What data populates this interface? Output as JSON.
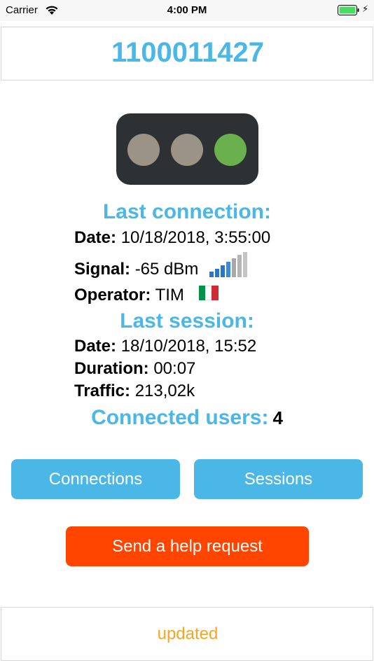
{
  "status_bar": {
    "carrier": "Carrier",
    "time": "4:00 PM",
    "battery_color": "#4cd964"
  },
  "device": {
    "id": "1100011427"
  },
  "traffic_light": {
    "lamps": [
      "off",
      "off",
      "green"
    ],
    "colors": {
      "off": "#9b9486",
      "green": "#6ab04c",
      "body": "#2e3133"
    }
  },
  "last_connection": {
    "title": "Last connection:",
    "date_label": "Date:",
    "date_value": "10/18/2018, 3:55:00",
    "signal_label": "Signal:",
    "signal_value": "-65 dBm",
    "signal_icon": "signal-strength-icon",
    "operator_label": "Operator:",
    "operator_value": "TIM",
    "operator_flag": "italy-flag-icon"
  },
  "last_session": {
    "title": "Last session:",
    "date_label": "Date:",
    "date_value": "18/10/2018, 15:52",
    "duration_label": "Duration:",
    "duration_value": "00:07",
    "traffic_label": "Traffic:",
    "traffic_value": "213,02k"
  },
  "connected_users": {
    "label": "Connected users:",
    "count": "4"
  },
  "buttons": {
    "connections": "Connections",
    "sessions": "Sessions",
    "help": "Send a help request"
  },
  "footer": {
    "status": "updated"
  },
  "colors": {
    "accent": "#4ab7e6",
    "help_button": "#ff4500",
    "footer_text": "#f5a623"
  }
}
